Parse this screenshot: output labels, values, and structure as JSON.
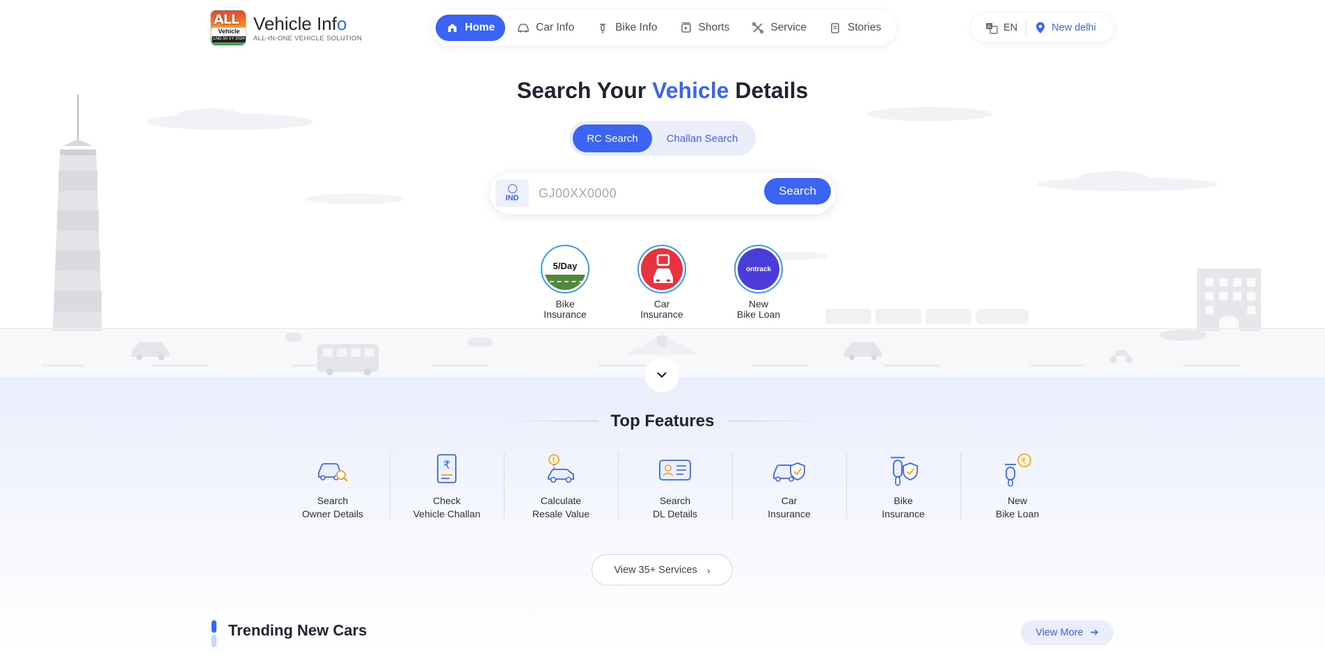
{
  "brand": {
    "logo_text": "ALL",
    "logo_sub": "Vehicle Info",
    "logo_strip": "LND 50 XY 2024",
    "name": "Vehicle Inf",
    "name_accent": "o",
    "tagline": "ALL-IN-ONE VEHICLE SOLUTION"
  },
  "nav": {
    "items": [
      {
        "label": "Home",
        "icon": "home-icon",
        "active": true
      },
      {
        "label": "Car Info",
        "icon": "car-icon",
        "active": false
      },
      {
        "label": "Bike Info",
        "icon": "bike-icon",
        "active": false
      },
      {
        "label": "Shorts",
        "icon": "shorts-icon",
        "active": false
      },
      {
        "label": "Service",
        "icon": "service-icon",
        "active": false
      },
      {
        "label": "Stories",
        "icon": "stories-icon",
        "active": false
      }
    ]
  },
  "header_right": {
    "language": "EN",
    "location": "New delhi"
  },
  "hero": {
    "title_pre": "Search Your ",
    "title_highlight": "Vehicle",
    "title_post": " Details",
    "tabs": [
      {
        "label": "RC Search",
        "active": true
      },
      {
        "label": "Challan Search",
        "active": false
      }
    ],
    "country_code": "IND",
    "search_placeholder": "GJ00XX0000",
    "search_button": "Search",
    "quick_links": [
      {
        "line1": "Bike",
        "line2": "Insurance",
        "badge": "5/Day"
      },
      {
        "line1": "Car",
        "line2": "Insurance",
        "badge": ""
      },
      {
        "line1": "New",
        "line2": "Bike Loan",
        "badge": "ontrack"
      }
    ]
  },
  "features": {
    "title": "Top Features",
    "items": [
      {
        "line1": "Search",
        "line2": "Owner Details"
      },
      {
        "line1": "Check",
        "line2": "Vehicle Challan"
      },
      {
        "line1": "Calculate",
        "line2": "Resale Value"
      },
      {
        "line1": "Search",
        "line2": "DL Details"
      },
      {
        "line1": "Car",
        "line2": "Insurance"
      },
      {
        "line1": "Bike",
        "line2": "Insurance"
      },
      {
        "line1": "New",
        "line2": "Bike Loan"
      }
    ],
    "view_all": "View 35+ Services"
  },
  "trending": {
    "title": "Trending New Cars",
    "view_more": "View More"
  },
  "colors": {
    "accent": "#3b64f5",
    "text": "#1f2430",
    "feature_bg": "#e9eefc",
    "car_badge": "#e8323e",
    "ontrack": "#4a3cd8"
  }
}
